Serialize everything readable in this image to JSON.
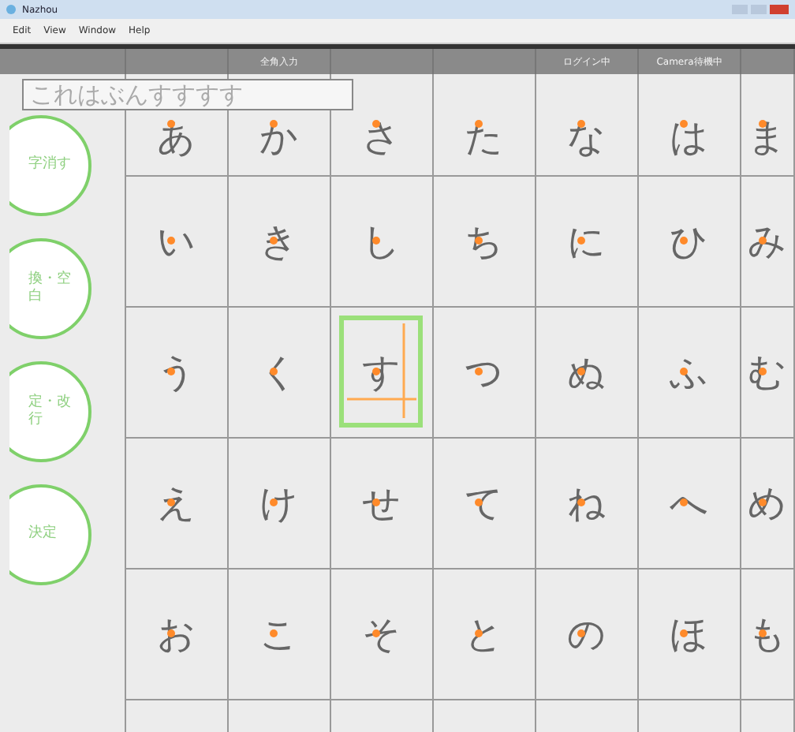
{
  "window": {
    "title": "Nazhou"
  },
  "menu": [
    "Edit",
    "View",
    "Window",
    "Help"
  ],
  "header": {
    "column_2": "全角入力",
    "column_5": "ログイン中",
    "column_6": "Camera待機中"
  },
  "input_text": "これはぶんすすすす",
  "side_buttons": [
    "字消す",
    "換・空白",
    "定・改行",
    "決定"
  ],
  "columns": [
    {
      "cells": [
        {
          "char": "あ",
          "selected": false
        },
        {
          "char": "い",
          "selected": false
        },
        {
          "char": "う",
          "selected": false
        },
        {
          "char": "え",
          "selected": false
        },
        {
          "char": "お",
          "selected": false
        }
      ]
    },
    {
      "cells": [
        {
          "char": "か",
          "selected": false
        },
        {
          "char": "き",
          "selected": false
        },
        {
          "char": "く",
          "selected": false
        },
        {
          "char": "け",
          "selected": false
        },
        {
          "char": "こ",
          "selected": false
        }
      ]
    },
    {
      "cells": [
        {
          "char": "さ",
          "selected": false
        },
        {
          "char": "し",
          "selected": false
        },
        {
          "char": "す",
          "selected": true
        },
        {
          "char": "せ",
          "selected": false
        },
        {
          "char": "そ",
          "selected": false
        }
      ]
    },
    {
      "cells": [
        {
          "char": "た",
          "selected": false
        },
        {
          "char": "ち",
          "selected": false
        },
        {
          "char": "つ",
          "selected": false
        },
        {
          "char": "て",
          "selected": false
        },
        {
          "char": "と",
          "selected": false
        }
      ]
    },
    {
      "cells": [
        {
          "char": "な",
          "selected": false
        },
        {
          "char": "に",
          "selected": false
        },
        {
          "char": "ぬ",
          "selected": false
        },
        {
          "char": "ね",
          "selected": false
        },
        {
          "char": "の",
          "selected": false
        }
      ]
    },
    {
      "cells": [
        {
          "char": "は",
          "selected": false
        },
        {
          "char": "ひ",
          "selected": false
        },
        {
          "char": "ふ",
          "selected": false
        },
        {
          "char": "へ",
          "selected": false
        },
        {
          "char": "ほ",
          "selected": false
        }
      ]
    },
    {
      "cells": [
        {
          "char": "ま",
          "selected": false
        },
        {
          "char": "み",
          "selected": false
        },
        {
          "char": "む",
          "selected": false
        },
        {
          "char": "め",
          "selected": false
        },
        {
          "char": "も",
          "selected": false
        }
      ]
    }
  ]
}
